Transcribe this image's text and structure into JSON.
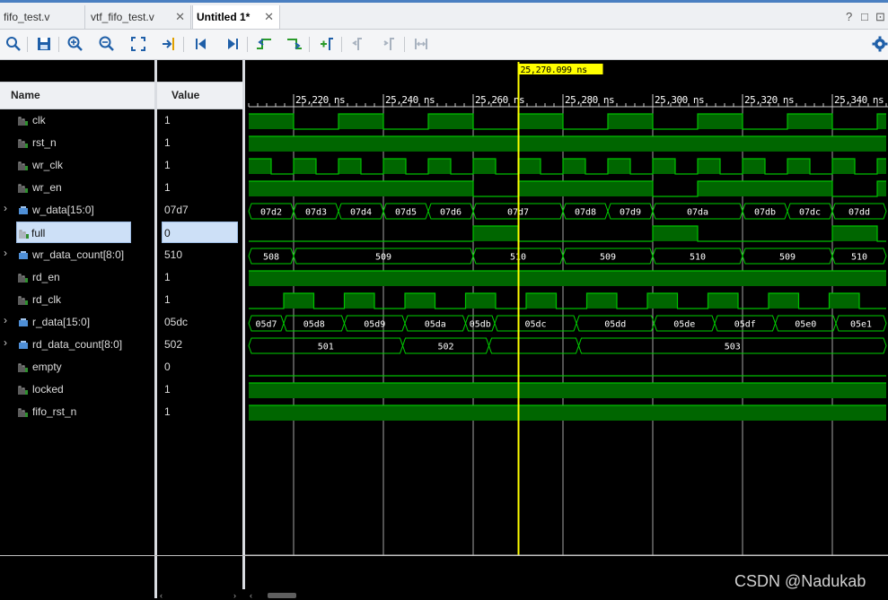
{
  "tabs": [
    {
      "label": "fifo_test.v",
      "active": false
    },
    {
      "label": "vtf_fifo_test.v",
      "active": false
    },
    {
      "label": "Untitled 1*",
      "active": true
    }
  ],
  "window_controls": {
    "help": "?",
    "restore": "□",
    "maximize": "⊡"
  },
  "toolbar": {
    "buttons": [
      "search-icon",
      "save-icon",
      "zoom-in-icon",
      "zoom-out-icon",
      "zoom-fit-icon",
      "goto-cursor-icon",
      "go-to-time-0-icon",
      "go-to-last-time-icon",
      "previous-transition-icon",
      "next-transition-icon",
      "add-marker-icon",
      "previous-marker-icon",
      "next-marker-icon",
      "swap-cursors-icon"
    ],
    "settings_icon": "gear-icon"
  },
  "headers": {
    "name": "Name",
    "value": "Value"
  },
  "signals": [
    {
      "name": "clk",
      "value": "1",
      "bus": false
    },
    {
      "name": "rst_n",
      "value": "1",
      "bus": false
    },
    {
      "name": "wr_clk",
      "value": "1",
      "bus": false
    },
    {
      "name": "wr_en",
      "value": "1",
      "bus": false
    },
    {
      "name": "w_data[15:0]",
      "value": "07d7",
      "bus": true
    },
    {
      "name": "full",
      "value": "0",
      "bus": false,
      "selected": true
    },
    {
      "name": "wr_data_count[8:0]",
      "value": "510",
      "bus": true
    },
    {
      "name": "rd_en",
      "value": "1",
      "bus": false
    },
    {
      "name": "rd_clk",
      "value": "1",
      "bus": false
    },
    {
      "name": "r_data[15:0]",
      "value": "05dc",
      "bus": true
    },
    {
      "name": "rd_data_count[8:0]",
      "value": "502",
      "bus": true
    },
    {
      "name": "empty",
      "value": "0",
      "bus": false
    },
    {
      "name": "locked",
      "value": "1",
      "bus": false
    },
    {
      "name": "fifo_rst_n",
      "value": "1",
      "bus": false
    }
  ],
  "cursor": {
    "label": "25,270.099 ns",
    "time": 25270.099
  },
  "timeline": {
    "start": 25210,
    "end": 25352,
    "tick_labels": [
      {
        "t": 25220,
        "label": "25,220 ns"
      },
      {
        "t": 25240,
        "label": "25,240 ns"
      },
      {
        "t": 25260,
        "label": "25,260 ns"
      },
      {
        "t": 25280,
        "label": "25,280 ns"
      },
      {
        "t": 25300,
        "label": "25,300 ns"
      },
      {
        "t": 25320,
        "label": "25,320 ns"
      },
      {
        "t": 25340,
        "label": "25,340 ns"
      }
    ]
  },
  "waves": {
    "clk": {
      "init": 1,
      "edges": [
        25220,
        25230,
        25240,
        25250,
        25260,
        25270,
        25280,
        25290,
        25300,
        25310,
        25320,
        25330,
        25340,
        25350
      ]
    },
    "rst_n": {
      "init": 1,
      "edges": []
    },
    "wr_clk": {
      "init": 1,
      "edges": [
        25215,
        25220,
        25225,
        25230,
        25235,
        25240,
        25245,
        25250,
        25255,
        25260,
        25265,
        25270,
        25275,
        25280,
        25285,
        25290,
        25295,
        25300,
        25305,
        25310,
        25315,
        25320,
        25325,
        25330,
        25335,
        25340,
        25345,
        25350
      ]
    },
    "wr_en": {
      "init": 1,
      "edges": [
        25260,
        25270,
        25300,
        25310,
        25340,
        25350
      ]
    },
    "w_data": {
      "segments": [
        {
          "t0": 25210,
          "t1": 25220,
          "label": "07d2"
        },
        {
          "t0": 25220,
          "t1": 25230,
          "label": "07d3"
        },
        {
          "t0": 25230,
          "t1": 25240,
          "label": "07d4"
        },
        {
          "t0": 25240,
          "t1": 25250,
          "label": "07d5"
        },
        {
          "t0": 25250,
          "t1": 25260,
          "label": "07d6"
        },
        {
          "t0": 25260,
          "t1": 25280,
          "label": "07d7"
        },
        {
          "t0": 25280,
          "t1": 25290,
          "label": "07d8"
        },
        {
          "t0": 25290,
          "t1": 25300,
          "label": "07d9"
        },
        {
          "t0": 25300,
          "t1": 25320,
          "label": "07da"
        },
        {
          "t0": 25320,
          "t1": 25330,
          "label": "07db"
        },
        {
          "t0": 25330,
          "t1": 25340,
          "label": "07dc"
        },
        {
          "t0": 25340,
          "t1": 25352,
          "label": "07dd"
        }
      ]
    },
    "full": {
      "init": 0,
      "edges": [
        25260,
        25270,
        25300,
        25310,
        25340,
        25350
      ]
    },
    "wr_data_count": {
      "segments": [
        {
          "t0": 25210,
          "t1": 25220,
          "label": "508"
        },
        {
          "t0": 25220,
          "t1": 25260,
          "label": "509"
        },
        {
          "t0": 25260,
          "t1": 25280,
          "label": "510"
        },
        {
          "t0": 25280,
          "t1": 25300,
          "label": "509"
        },
        {
          "t0": 25300,
          "t1": 25320,
          "label": "510"
        },
        {
          "t0": 25320,
          "t1": 25340,
          "label": "509"
        },
        {
          "t0": 25340,
          "t1": 25352,
          "label": "510"
        }
      ]
    },
    "rd_en": {
      "init": 1,
      "edges": []
    },
    "rd_clk": {
      "init": 0,
      "edges": [
        25217.8,
        25224.5,
        25231.3,
        25238,
        25244.8,
        25251.5,
        25258.3,
        25265,
        25271.8,
        25278.5,
        25285.3,
        25292,
        25298.8,
        25305.5,
        25312.3,
        25319,
        25325.8,
        25332.5,
        25339.3,
        25346
      ]
    },
    "r_data": {
      "segments": [
        {
          "t0": 25210,
          "t1": 25217.8,
          "label": "05d7"
        },
        {
          "t0": 25217.8,
          "t1": 25231.3,
          "label": "05d8"
        },
        {
          "t0": 25231.3,
          "t1": 25244.8,
          "label": "05d9"
        },
        {
          "t0": 25244.8,
          "t1": 25258.3,
          "label": "05da"
        },
        {
          "t0": 25258.3,
          "t1": 25264.8,
          "label": "05db"
        },
        {
          "t0": 25264.8,
          "t1": 25283,
          "label": "05dc"
        },
        {
          "t0": 25283,
          "t1": 25300.3,
          "label": "05dd"
        },
        {
          "t0": 25300.3,
          "t1": 25313.8,
          "label": "05de"
        },
        {
          "t0": 25313.8,
          "t1": 25327.3,
          "label": "05df"
        },
        {
          "t0": 25327.3,
          "t1": 25340.8,
          "label": "05e0"
        },
        {
          "t0": 25340.8,
          "t1": 25352,
          "label": "05e1"
        }
      ]
    },
    "rd_data_count": {
      "segments": [
        {
          "t0": 25210,
          "t1": 25244.3,
          "label": "501"
        },
        {
          "t0": 25244.3,
          "t1": 25263.5,
          "label": "502"
        },
        {
          "t0": 25263.5,
          "t1": 25283.5,
          "label": ""
        },
        {
          "t0": 25283.5,
          "t1": 25352,
          "label": "503"
        }
      ]
    },
    "empty": {
      "init": 0,
      "edges": []
    },
    "locked": {
      "init": 1,
      "edges": []
    },
    "fifo_rst_n": {
      "init": 1,
      "edges": []
    }
  },
  "colors": {
    "wave": "#00c000",
    "fill": "#006600",
    "bus": "#00d000",
    "cursor": "#ffff00",
    "grid": "#cfcfcf",
    "text": "#ffffff"
  },
  "watermark": "CSDN @Nadukab"
}
